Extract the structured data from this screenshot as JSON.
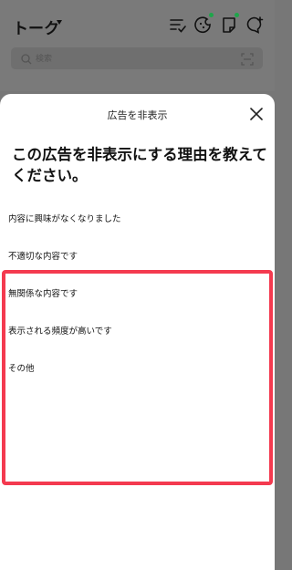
{
  "app": {
    "title": "トーク",
    "search_placeholder": "検索"
  },
  "header_icons": [
    "list-check-icon",
    "cookie-sparkle-icon",
    "note-icon",
    "chat-add-icon"
  ],
  "badge_color": "#1ea64a",
  "sheet": {
    "title": "広告を非表示",
    "question": "この広告を非表示にする理由を教えてください。",
    "reasons": [
      "内容に興味がなくなりました",
      "不適切な内容です",
      "無関係な内容です",
      "表示される頻度が高いです",
      "その他"
    ]
  },
  "highlight_color": "#f43a4f"
}
